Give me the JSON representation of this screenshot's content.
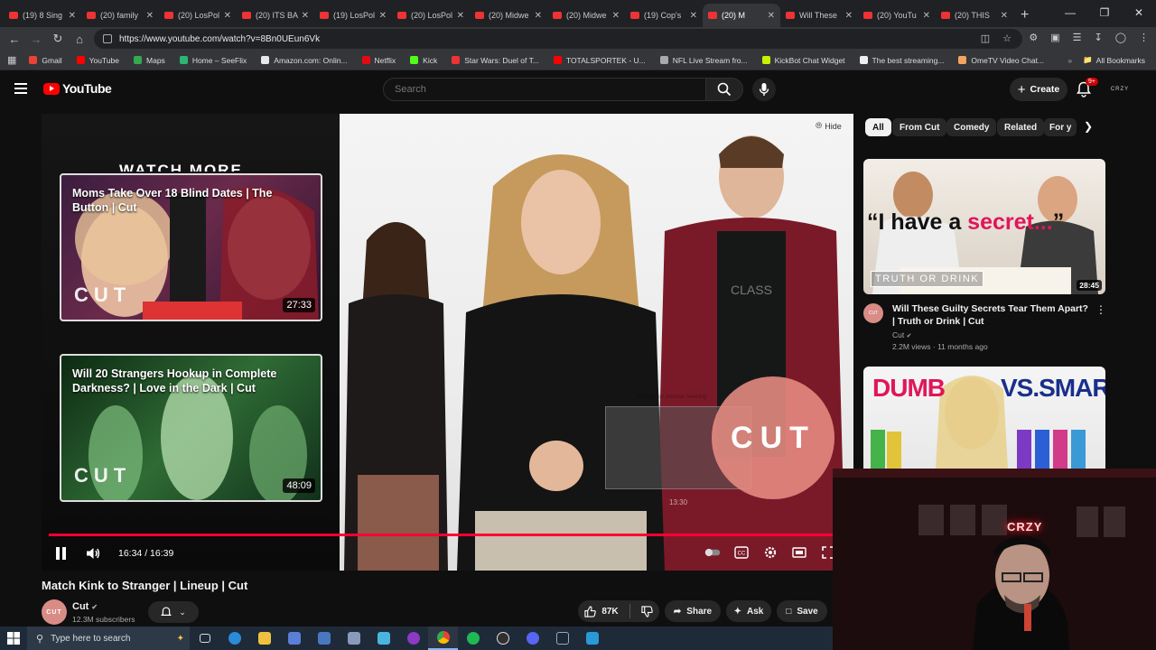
{
  "browser": {
    "tabs": [
      {
        "label": "(19) 8 Sing",
        "active": false
      },
      {
        "label": "(20) family",
        "active": false
      },
      {
        "label": "(20) LosPol",
        "active": false
      },
      {
        "label": "(20) ITS BA",
        "active": false
      },
      {
        "label": "(19) LosPol",
        "active": false
      },
      {
        "label": "(20) LosPol",
        "active": false
      },
      {
        "label": "(20) Midwe",
        "active": false
      },
      {
        "label": "(20) Midwe",
        "active": false
      },
      {
        "label": "(19) Cop's",
        "active": false
      },
      {
        "label": "(20) M",
        "active": true
      },
      {
        "label": "Will These",
        "active": false
      },
      {
        "label": "(20) YouTu",
        "active": false
      },
      {
        "label": "(20) THIS",
        "active": false
      }
    ],
    "url": "https://www.youtube.com/watch?v=8Bn0UEun6Vk",
    "bookmarks": [
      {
        "label": "Gmail",
        "color": "#ea4335"
      },
      {
        "label": "YouTube",
        "color": "#ff0000"
      },
      {
        "label": "Maps",
        "color": "#34a853"
      },
      {
        "label": "Home – SeeFlix",
        "color": "#2bb673"
      },
      {
        "label": "Amazon.com: Onlin...",
        "color": "#e8e8e8"
      },
      {
        "label": "Netflix",
        "color": "#e50914"
      },
      {
        "label": "Kick",
        "color": "#53fc18"
      },
      {
        "label": "Star Wars: Duel of T...",
        "color": "#e33"
      },
      {
        "label": "TOTALSPORTEK - U...",
        "color": "#ff0000"
      },
      {
        "label": "NFL Live Stream fro...",
        "color": "#aaa"
      },
      {
        "label": "KickBot Chat Widget",
        "color": "#c8f000"
      },
      {
        "label": "The best streaming...",
        "color": "#eee"
      },
      {
        "label": "OmeTV Video Chat...",
        "color": "#f4a460"
      }
    ],
    "all_bookmarks": "All Bookmarks"
  },
  "youtube": {
    "logo_text": "YouTube",
    "search_placeholder": "Search",
    "create_label": "Create",
    "notif_count": "9+",
    "avatar_text": "CRZY"
  },
  "player": {
    "endscreen_heading": "WATCH MORE",
    "endscreen_cards": [
      {
        "title": "Moms Take Over 18 Blind Dates | The Button | Cut",
        "duration": "27:33",
        "logo": "CUT"
      },
      {
        "title": "Will 20 Strangers Hookup in Complete Darkness? | Love in the Dark | Cut",
        "duration": "48:09",
        "logo": "CUT"
      }
    ],
    "hide_label": "Hide",
    "brand_overlay": "CUT",
    "preview_time": "13:30",
    "preview_hint": "Pull up for precise seeking",
    "timecode": "16:34 / 16:39",
    "progress": 0.995
  },
  "video": {
    "title": "Match Kink to Stranger | Lineup | Cut",
    "channel": "Cut",
    "channel_avatar": "CUT",
    "subscribers": "12.3M subscribers",
    "likes": "87K",
    "share_label": "Share",
    "ask_label": "Ask",
    "save_label": "Save"
  },
  "sidebar": {
    "chips": [
      "All",
      "From Cut",
      "Comedy",
      "Related",
      "For y"
    ],
    "recs": [
      {
        "thumb_text_1": "“I have a ",
        "thumb_text_2": "secret...",
        "thumb_text_3": "”",
        "thumb_badge": "TRUTH OR DRINK",
        "duration": "28:45",
        "title": "Will These Guilty Secrets Tear Them Apart? | Truth or Drink | Cut",
        "channel": "Cut",
        "stats": "2.2M views · 11 months ago"
      },
      {
        "thumb_text_1": "DUMB",
        "thumb_text_2": "VS.SMART"
      }
    ]
  },
  "webcam": {
    "sign": "CRZY"
  },
  "taskbar": {
    "search_placeholder": "Type here to search"
  },
  "colors": {
    "accent": "#ff0033",
    "brand_pink": "#e88c82"
  }
}
